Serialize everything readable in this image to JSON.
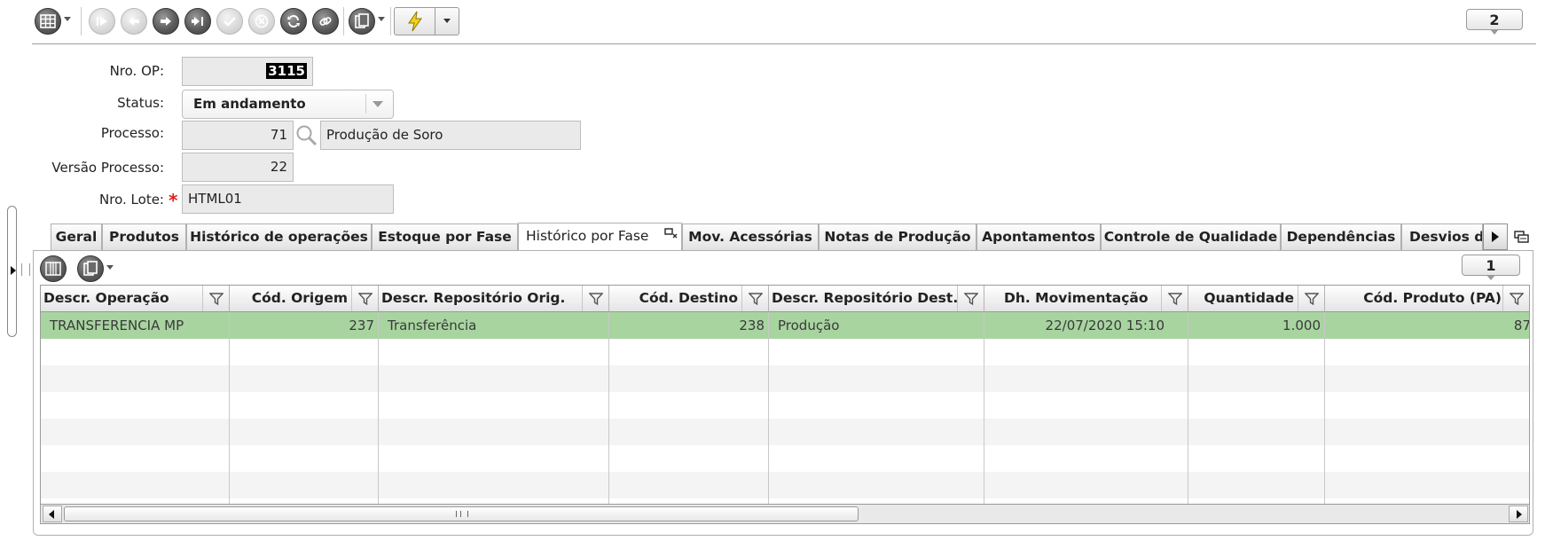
{
  "toolbar": {
    "icons": [
      "grid-menu-icon",
      "first-record-icon",
      "previous-record-icon",
      "next-record-icon",
      "last-record-icon",
      "confirm-icon",
      "cancel-icon",
      "refresh-icon",
      "link-icon",
      "copy-icon",
      "lightning-icon",
      "dropdown-icon"
    ],
    "page_number": "2"
  },
  "form": {
    "nro_op": {
      "label": "Nro. OP:",
      "value": "3115"
    },
    "status": {
      "label": "Status:",
      "value": "Em andamento"
    },
    "processo": {
      "label": "Processo:",
      "code": "71",
      "description": "Produção de Soro"
    },
    "versao_processo": {
      "label": "Versão Processo:",
      "value": "22"
    },
    "nro_lote": {
      "label": "Nro. Lote:",
      "value": "HTML01",
      "required_mark": "*"
    }
  },
  "tabs": [
    {
      "label": "Geral"
    },
    {
      "label": "Produtos"
    },
    {
      "label": "Histórico de operações"
    },
    {
      "label": "Estoque por Fase"
    },
    {
      "label": "Histórico por Fase",
      "active": true
    },
    {
      "label": "Mov. Acessórias"
    },
    {
      "label": "Notas de Produção"
    },
    {
      "label": "Apontamentos"
    },
    {
      "label": "Controle de Qualidade"
    },
    {
      "label": "Dependências"
    },
    {
      "label": "Desvios d"
    }
  ],
  "panel": {
    "page_number": "1"
  },
  "grid": {
    "columns": [
      "Descr. Operação",
      "Cód. Origem",
      "Descr. Repositório Orig.",
      "Cód. Destino",
      "Descr. Repositório Dest.",
      "Dh. Movimentação",
      "Quantidade",
      "Cód. Produto (PA)"
    ],
    "rows": [
      [
        "TRANSFERENCIA MP",
        "237",
        "Transferência",
        "238",
        "Produção",
        "22/07/2020 15:10",
        "1.000",
        "87"
      ]
    ],
    "selected_row_color": "#a8d4a0",
    "alt_row_color": "#f4f4f4"
  }
}
